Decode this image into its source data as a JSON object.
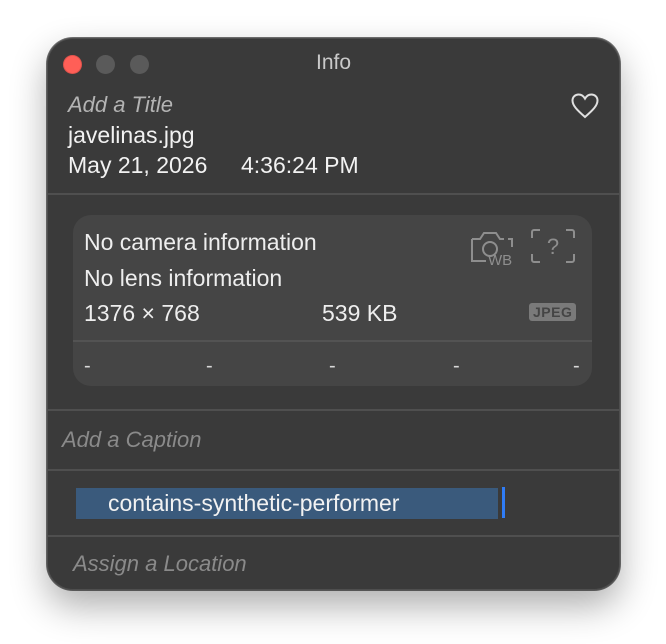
{
  "window": {
    "title": "Info"
  },
  "header": {
    "title_placeholder": "Add a Title",
    "filename": "javelinas.jpg",
    "date": "May 21, 2026",
    "time": "4:36:24 PM",
    "favorite_icon": "heart-icon"
  },
  "metadata": {
    "camera": "No camera information",
    "lens": "No lens information",
    "dimensions": "1376 × 768",
    "file_size": "539 KB",
    "format_badge": "JPEG",
    "camera_icon": "camera-wb-icon",
    "unknown_icon": "question-icon",
    "exif_values": [
      "-",
      "-",
      "-",
      "-",
      "-"
    ]
  },
  "caption": {
    "placeholder": "Add a Caption"
  },
  "keywords": {
    "value": "contains-synthetic-performer"
  },
  "location": {
    "placeholder": "Assign a Location"
  },
  "colors": {
    "window_bg": "#3a3a3a",
    "card_bg": "#454545",
    "close": "#ff5f57",
    "selection": "#3a5a7c",
    "caret": "#2f7cf6"
  }
}
